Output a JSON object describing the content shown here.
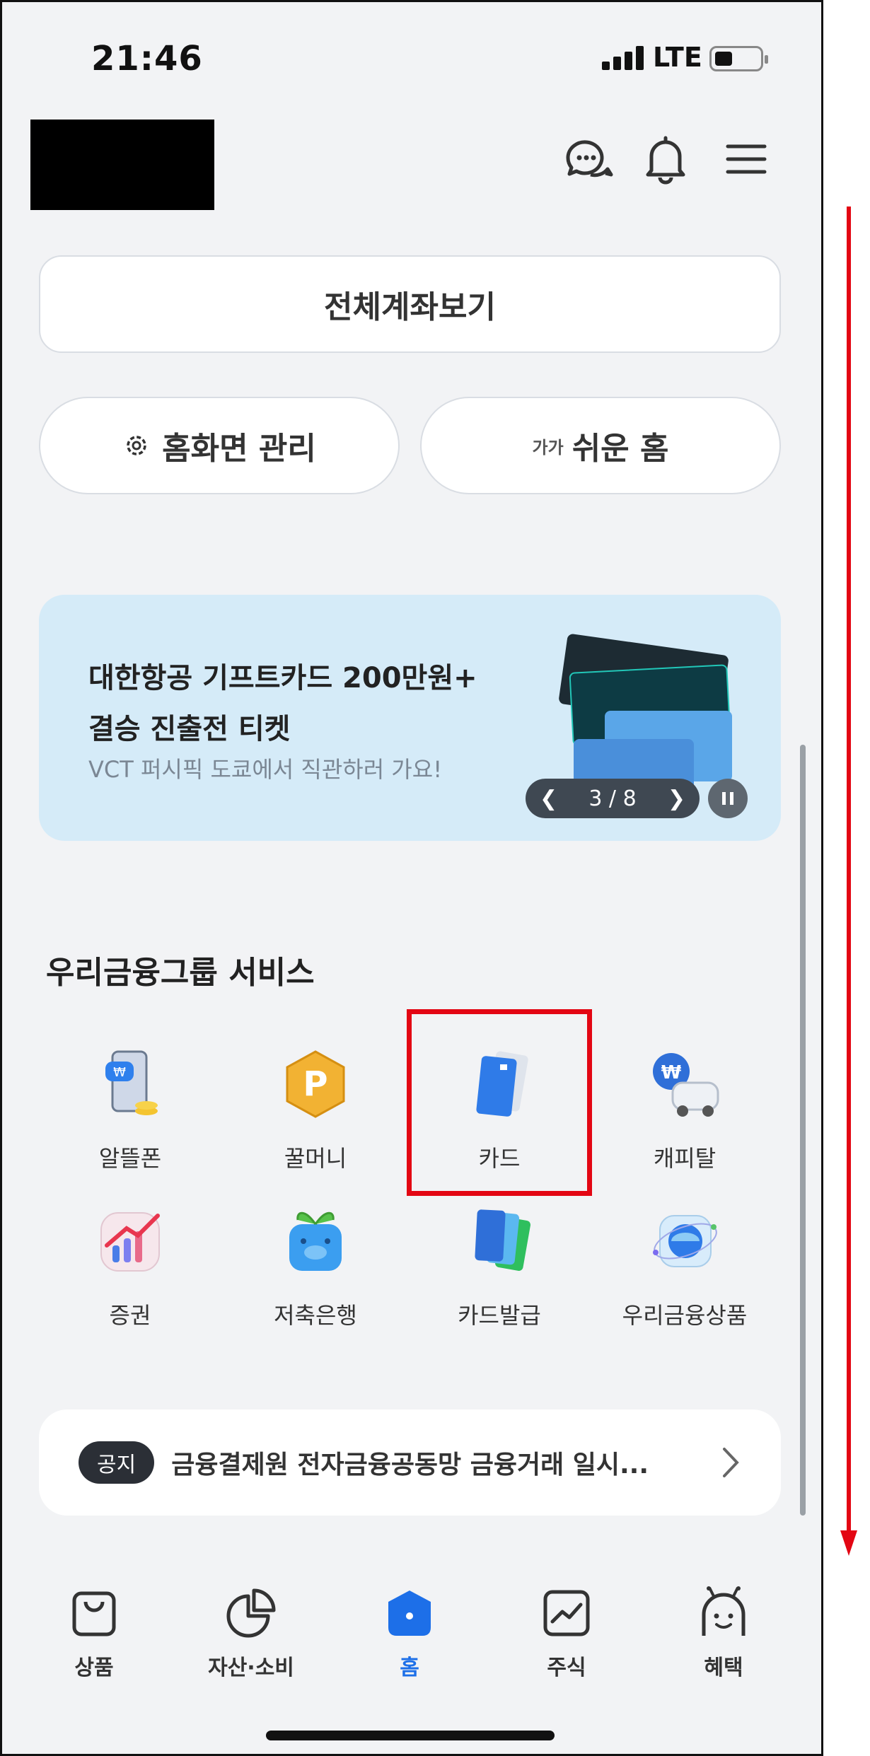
{
  "status_bar": {
    "time": "21:46",
    "network": "LTE"
  },
  "header": {
    "icons": [
      "chat-icon",
      "bell-icon",
      "menu-icon"
    ]
  },
  "buttons": {
    "all_accounts": "전체계좌보기",
    "home_manage": "홈화면 관리",
    "easy_home_prefix": "가가",
    "easy_home": "쉬운 홈"
  },
  "banner": {
    "title": "대한항공 기프트카드 200만원+\n결승 진출전 티켓",
    "subtitle": "VCT 퍼시픽 도쿄에서 직관하러 가요!",
    "pager": "3 / 8",
    "background": "#d5ebf8"
  },
  "services": {
    "title": "우리금융그룹 서비스",
    "items": [
      {
        "label": "알뜰폰",
        "icon": "phone-icon"
      },
      {
        "label": "꿀머니",
        "icon": "coin-icon"
      },
      {
        "label": "카드",
        "icon": "card-icon"
      },
      {
        "label": "캐피탈",
        "icon": "car-icon"
      },
      {
        "label": "증권",
        "icon": "chart-icon"
      },
      {
        "label": "저축은행",
        "icon": "piggy-icon"
      },
      {
        "label": "카드발급",
        "icon": "cards-icon"
      },
      {
        "label": "우리금융상품",
        "icon": "globe-icon"
      }
    ]
  },
  "notice": {
    "tag": "공지",
    "text": "금융결제원 전자금융공동망 금융거래 일시..."
  },
  "tabbar": {
    "items": [
      {
        "label": "상품",
        "icon": "bag-icon"
      },
      {
        "label": "자산·소비",
        "icon": "pie-icon"
      },
      {
        "label": "홈",
        "icon": "home-icon",
        "active": true
      },
      {
        "label": "주식",
        "icon": "stock-icon"
      },
      {
        "label": "혜택",
        "icon": "benefit-icon"
      }
    ],
    "active_color": "#1d6fe8"
  },
  "annotations": {
    "highlight_color": "#e30613"
  }
}
